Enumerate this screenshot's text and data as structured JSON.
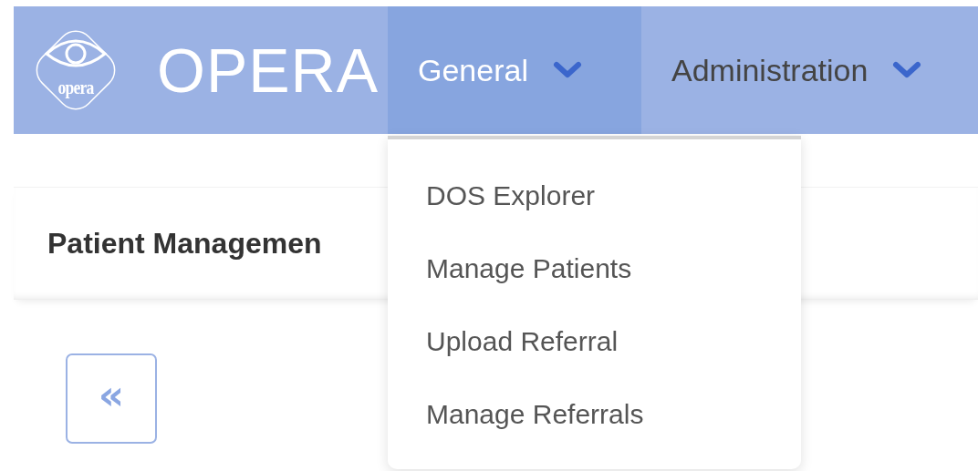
{
  "navbar": {
    "logo_text": "opera",
    "brand": "OPERA",
    "menus": [
      {
        "label": "General",
        "selected": true
      },
      {
        "label": "Administration",
        "selected": false
      }
    ]
  },
  "dropdown": {
    "items": [
      {
        "label": "DOS Explorer"
      },
      {
        "label": "Manage Patients"
      },
      {
        "label": "Upload Referral"
      },
      {
        "label": "Manage Referrals"
      }
    ]
  },
  "panel": {
    "title": "Patient Managemen"
  },
  "back_button": {
    "label": "«"
  }
}
